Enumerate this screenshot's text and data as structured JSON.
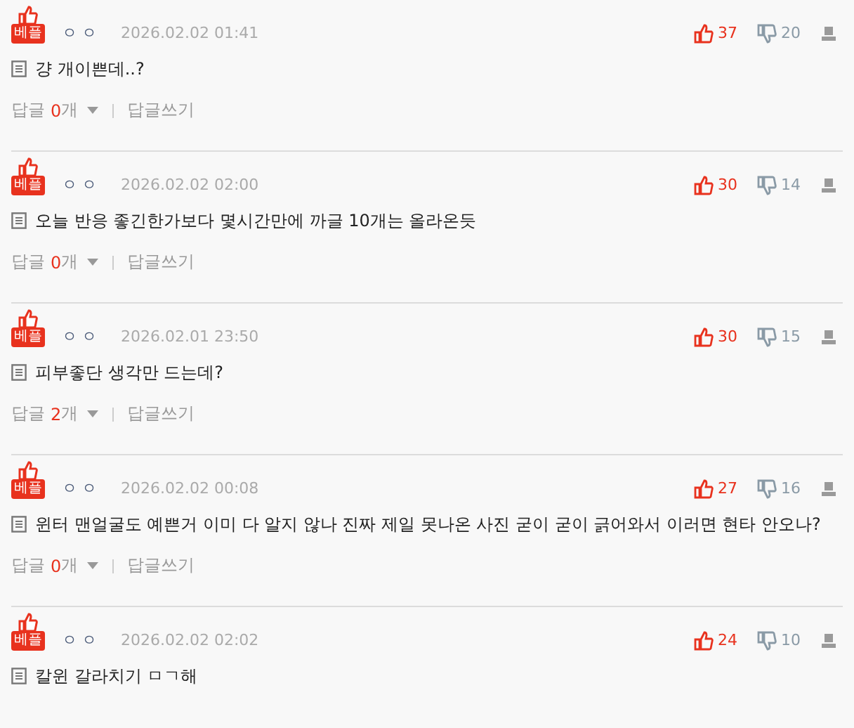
{
  "comments": [
    {
      "badge": "베플",
      "author": "ㅇㅇ",
      "date": "2026.02.02 01:41",
      "likes": "37",
      "dislikes": "20",
      "text": "걍 개이쁜데..?",
      "reply_prefix": "답글",
      "reply_count": "0",
      "reply_suffix": "개",
      "write_reply": "답글쓰기"
    },
    {
      "badge": "베플",
      "author": "ㅇㅇ",
      "date": "2026.02.02 02:00",
      "likes": "30",
      "dislikes": "14",
      "text": "오늘 반응 좋긴한가보다 몇시간만에 까글 10개는 올라온듯",
      "reply_prefix": "답글",
      "reply_count": "0",
      "reply_suffix": "개",
      "write_reply": "답글쓰기"
    },
    {
      "badge": "베플",
      "author": "ㅇㅇ",
      "date": "2026.02.01 23:50",
      "likes": "30",
      "dislikes": "15",
      "text": "피부좋단 생각만 드는데?",
      "reply_prefix": "답글",
      "reply_count": "2",
      "reply_suffix": "개",
      "write_reply": "답글쓰기"
    },
    {
      "badge": "베플",
      "author": "ㅇㅇ",
      "date": "2026.02.02 00:08",
      "likes": "27",
      "dislikes": "16",
      "text": "윈터 맨얼굴도 예쁜거 이미 다 알지 않나 진짜 제일 못나온 사진 굳이 굳이 긁어와서 이러면 현타 안오나?",
      "reply_prefix": "답글",
      "reply_count": "0",
      "reply_suffix": "개",
      "write_reply": "답글쓰기"
    },
    {
      "badge": "베플",
      "author": "ㅇㅇ",
      "date": "2026.02.02 02:02",
      "likes": "24",
      "dislikes": "10",
      "text": "칼윈 갈라치기 ㅁㄱ해"
    }
  ]
}
